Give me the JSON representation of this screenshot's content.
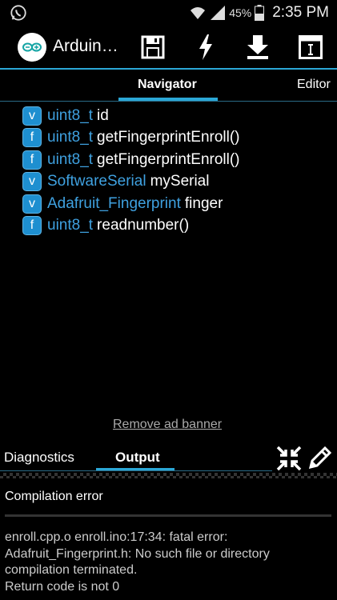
{
  "status_bar": {
    "battery": "45%",
    "time": "2:35 PM"
  },
  "app": {
    "title": "Arduin…"
  },
  "tabs": {
    "navigator": "Navigator",
    "editor": "Editor"
  },
  "navigator_items": [
    {
      "kind": "v",
      "type": "uint8_t",
      "name": "id"
    },
    {
      "kind": "f",
      "type": "uint8_t",
      "name": "getFingerprintEnroll()"
    },
    {
      "kind": "f",
      "type": "uint8_t",
      "name": "getFingerprintEnroll()"
    },
    {
      "kind": "v",
      "type": "SoftwareSerial",
      "name": "mySerial"
    },
    {
      "kind": "v",
      "type": "Adafruit_Fingerprint",
      "name": "finger"
    },
    {
      "kind": "f",
      "type": "uint8_t",
      "name": "readnumber()"
    }
  ],
  "ad_banner_link": "Remove ad banner",
  "bottom_tabs": {
    "diagnostics": "Diagnostics",
    "output": "Output"
  },
  "output": {
    "status": "Compilation error",
    "lines": [
      "enroll.cpp.o enroll.ino:17:34: fatal error:",
      "Adafruit_Fingerprint.h: No such file or directory",
      "compilation terminated.",
      "Return code is not 0"
    ]
  },
  "colors": {
    "accent": "#2ba7d6",
    "type_blue": "#3fa1e0",
    "badge_blue": "#1e8fd0"
  },
  "icons": [
    "whatsapp-icon",
    "wifi-icon",
    "signal-icon",
    "battery-icon",
    "save-icon",
    "lightning-icon",
    "download-icon",
    "serial-monitor-icon",
    "collapse-icon",
    "pencil-icon"
  ]
}
